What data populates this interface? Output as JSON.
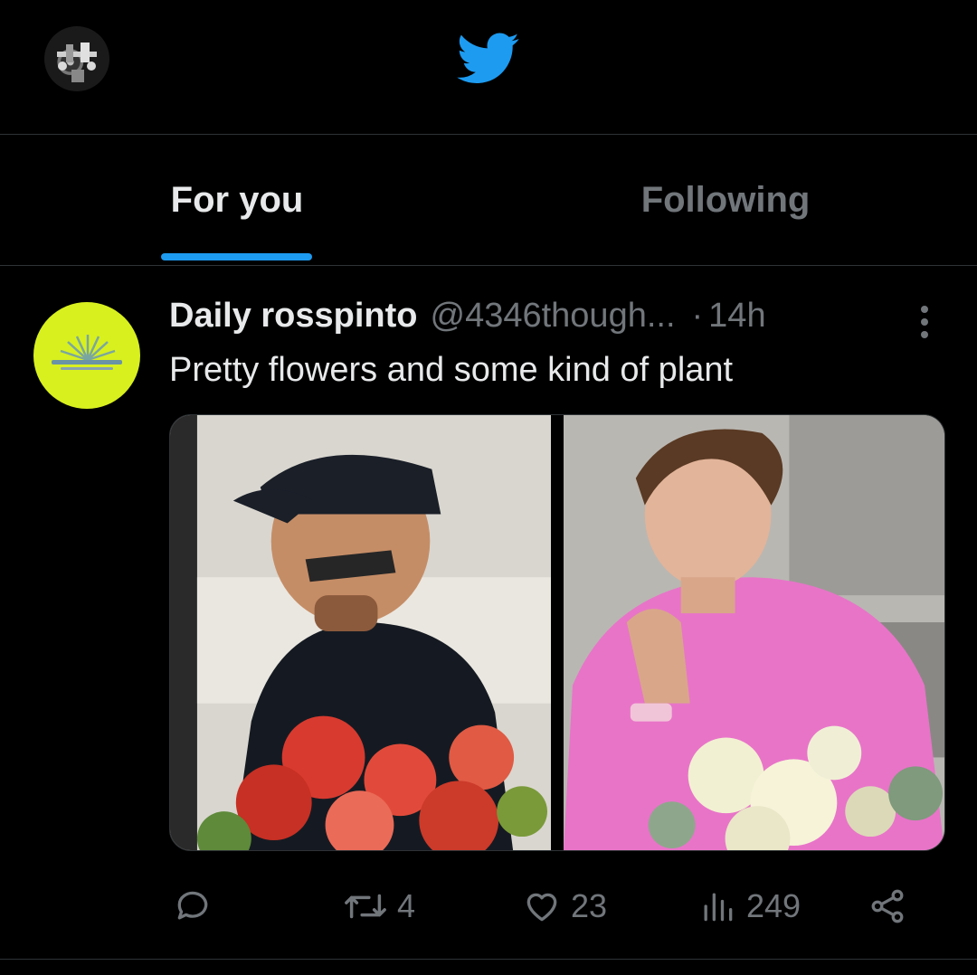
{
  "tabs": {
    "for_you": "For you",
    "following": "Following"
  },
  "tweet": {
    "author_name": "Daily rosspinto",
    "author_handle": "@4346though...",
    "separator": "·",
    "time": "14h",
    "text": "Pretty flowers and some kind of plant",
    "actions": {
      "reply_count": "",
      "retweet_count": "4",
      "like_count": "23",
      "view_count": "249"
    }
  },
  "icons": {
    "logo": "twitter-bird-icon",
    "more": "more-vertical-icon",
    "reply": "reply-icon",
    "retweet": "retweet-icon",
    "like": "heart-icon",
    "views": "views-icon",
    "share": "share-icon"
  },
  "colors": {
    "background": "#000000",
    "accent": "#1d9bf0",
    "text_primary": "#e7e9ea",
    "text_secondary": "#71767b",
    "divider": "#2f3336",
    "author_avatar": "#d8f01e"
  }
}
